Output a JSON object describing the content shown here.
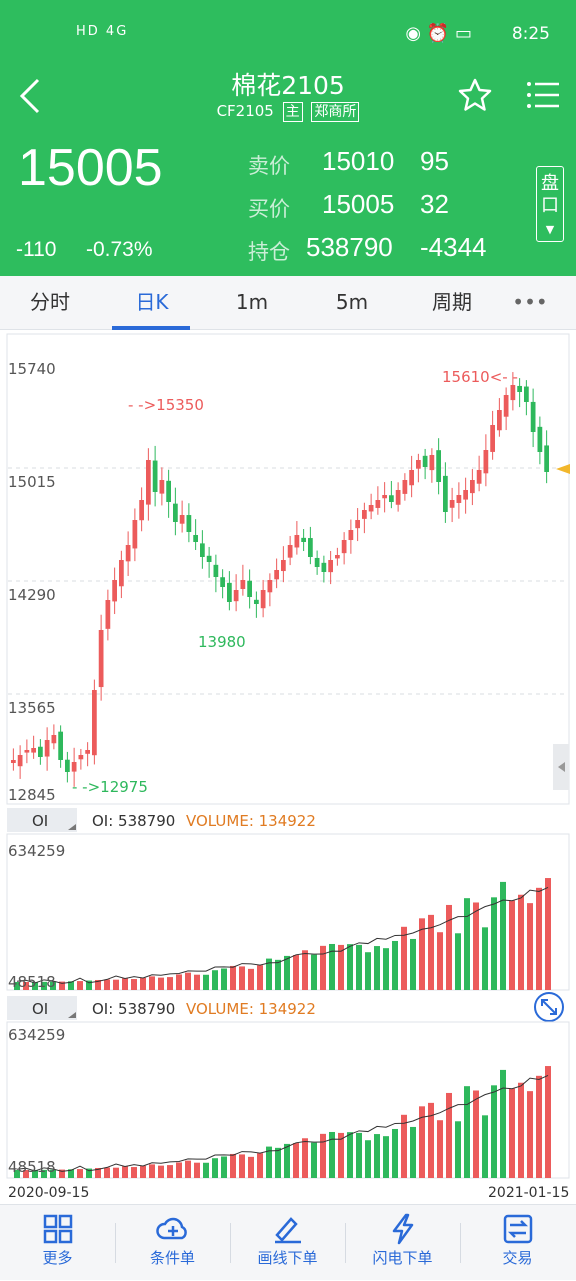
{
  "status": {
    "left": "HD 4G",
    "time": "8:25"
  },
  "header": {
    "title": "棉花2105",
    "code": "CF2105",
    "tag_main": "主",
    "tag_exchange": "郑商所"
  },
  "quote": {
    "last": "15005",
    "change": "-110",
    "change_pct": "-0.73%",
    "ask_label": "卖价",
    "ask_price": "15010",
    "ask_vol": "95",
    "bid_label": "买价",
    "bid_price": "15005",
    "bid_vol": "32",
    "oi_label": "持仓",
    "oi": "538790",
    "oi_change": "-4344",
    "pankou_label": "盘口"
  },
  "tabs": [
    {
      "label": "分时"
    },
    {
      "label": "日K"
    },
    {
      "label": "1m"
    },
    {
      "label": "5m"
    },
    {
      "label": "周期"
    },
    {
      "label": "•••"
    }
  ],
  "kline": {
    "price_ticks": [
      "15740",
      "15015",
      "14290",
      "13565",
      "12845"
    ],
    "mark_high": "- ->15350",
    "mark_low": "13980",
    "mark_low2": "- ->12975",
    "mark_high2": "15610<- -",
    "indicator_btn": "OI",
    "oi_text": "OI: 538790",
    "volume_text": "VOLUME: 134922",
    "sub_top": "634259",
    "sub_bottom": "48518",
    "date_start": "2020-09-15",
    "date_end": "2021-01-15"
  },
  "toolbar": [
    {
      "label": "更多",
      "icon": "grid-icon"
    },
    {
      "label": "条件单",
      "icon": "cloud-plus-icon"
    },
    {
      "label": "画线下单",
      "icon": "draw-line-icon"
    },
    {
      "label": "闪电下单",
      "icon": "lightning-icon"
    },
    {
      "label": "交易",
      "icon": "trade-icon"
    }
  ],
  "colors": {
    "up": "#ec5b5b",
    "down": "#2eb85c",
    "accent": "#2a6ad8",
    "header": "#2ebd5e"
  }
}
